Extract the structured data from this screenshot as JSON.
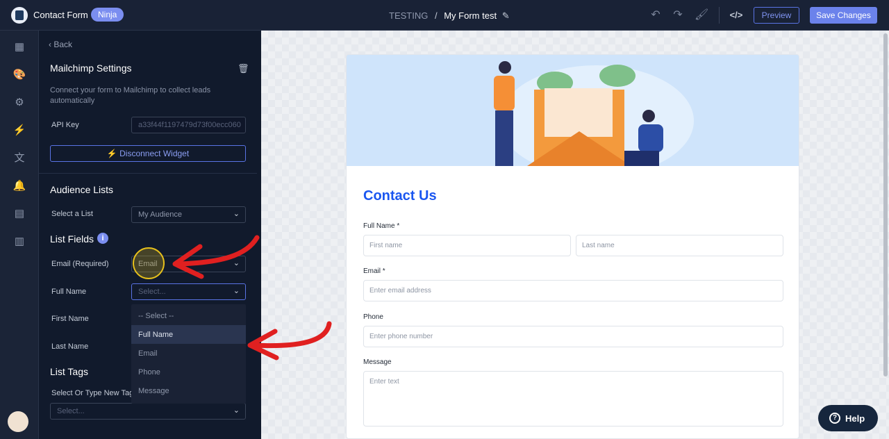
{
  "header": {
    "app_title": "Contact Form",
    "badge": "Ninja",
    "breadcrumb_parent": "TESTING",
    "breadcrumb_sep": "/",
    "form_name": "My Form test",
    "preview_label": "Preview",
    "save_label": "Save Changes"
  },
  "panel": {
    "back_label": "Back",
    "title": "Mailchimp Settings",
    "description": "Connect your form to Mailchimp to collect leads automatically",
    "api_key_label": "API Key",
    "api_key_value": "a33f44f1197479d73f00ecc060",
    "disconnect_label": "Disconnect Widget",
    "audience_heading": "Audience Lists",
    "select_list_label": "Select a List",
    "select_list_value": "My Audience",
    "list_fields_heading": "List Fields",
    "email_label": "Email (Required)",
    "email_value": "Email",
    "full_name_label": "Full Name",
    "full_name_placeholder": "Select...",
    "first_name_label": "First Name",
    "last_name_label": "Last Name",
    "tags_heading": "List Tags",
    "tags_label": "Select Or Type New Tags",
    "tags_placeholder": "Select...",
    "dropdown_options": [
      "-- Select --",
      "Full Name",
      "Email",
      "Phone",
      "Message"
    ],
    "dropdown_selected": "Full Name"
  },
  "form": {
    "title": "Contact Us",
    "full_name_label": "Full Name *",
    "first_name_placeholder": "First name",
    "last_name_placeholder": "Last name",
    "email_label": "Email *",
    "email_placeholder": "Enter email address",
    "phone_label": "Phone",
    "phone_placeholder": "Enter phone number",
    "message_label": "Message",
    "message_placeholder": "Enter text"
  },
  "help_label": "Help",
  "colors": {
    "accent": "#6b82eb",
    "form_title": "#1a56f0",
    "annotation_arrow": "#e02020",
    "highlight": "#e6c01c"
  }
}
